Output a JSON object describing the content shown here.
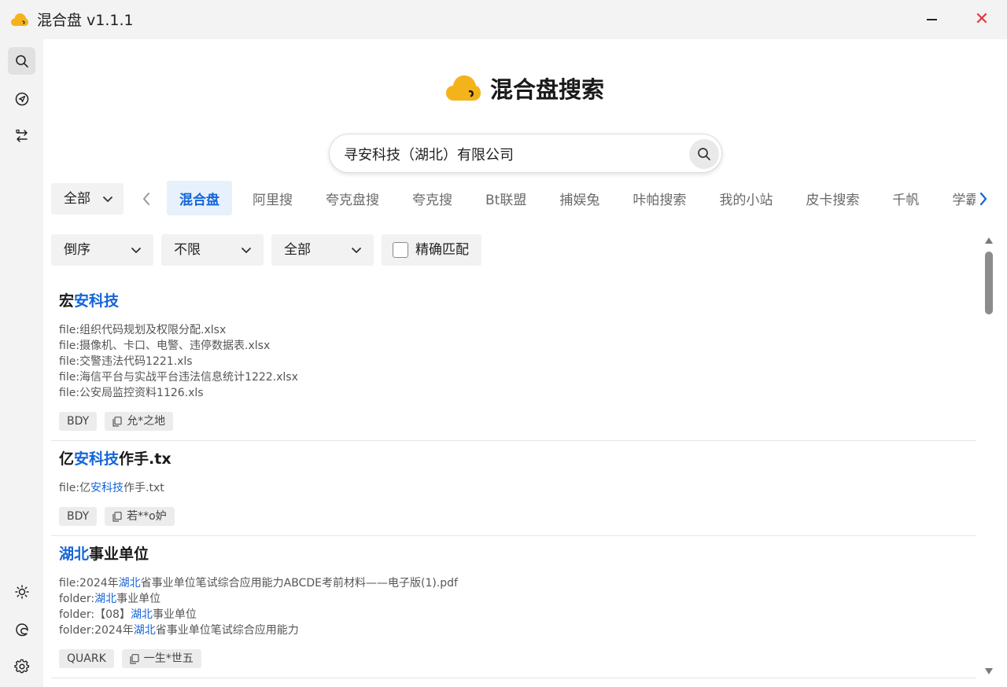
{
  "window": {
    "title": "混合盘 v1.1.1",
    "close_glyph": "✕",
    "accent_color": "#1565d8",
    "logo_color": "#f5b31b"
  },
  "sidebar": {
    "top": [
      {
        "icon": "search-icon",
        "active": true
      },
      {
        "icon": "send-icon",
        "active": false
      },
      {
        "icon": "transfer-icon",
        "active": false
      }
    ],
    "bottom": [
      {
        "icon": "theme-icon"
      },
      {
        "icon": "edge-icon"
      },
      {
        "icon": "settings-icon"
      }
    ]
  },
  "header": {
    "brand_title": "混合盘搜索"
  },
  "search": {
    "query": "寻安科技（湖北）有限公司"
  },
  "scope": {
    "selected": "全部"
  },
  "tabs": [
    "混合盘",
    "阿里搜",
    "夸克盘搜",
    "夸克搜",
    "Bt联盟",
    "捕娱兔",
    "咔帕搜索",
    "我的小站",
    "皮卡搜索",
    "千帆",
    "学霸"
  ],
  "active_tab": "混合盘",
  "filters": {
    "order": "倒序",
    "time": "不限",
    "type": "全部",
    "exact_label": "精确匹配",
    "exact_checked": false
  },
  "results": [
    {
      "title_parts": [
        {
          "t": "宏",
          "hl": false
        },
        {
          "t": "安科技",
          "hl": true
        }
      ],
      "files": [
        [
          {
            "t": "file:组织代码规划及权限分配.xlsx",
            "hl": false
          }
        ],
        [
          {
            "t": "file:摄像机、卡口、电警、违停数据表.xlsx",
            "hl": false
          }
        ],
        [
          {
            "t": "file:交警违法代码1221.xls",
            "hl": false
          }
        ],
        [
          {
            "t": "file:海信平台与实战平台违法信息统计1222.xlsx",
            "hl": false
          }
        ],
        [
          {
            "t": "file:公安局监控资料1126.xls",
            "hl": false
          }
        ]
      ],
      "source": "BDY",
      "owner": "允*之地"
    },
    {
      "title_parts": [
        {
          "t": "亿",
          "hl": false
        },
        {
          "t": "安科技",
          "hl": true
        },
        {
          "t": "作手.tx",
          "hl": false
        }
      ],
      "files": [
        [
          {
            "t": "file:亿",
            "hl": false
          },
          {
            "t": "安科技",
            "hl": true
          },
          {
            "t": "作手.txt",
            "hl": false
          }
        ]
      ],
      "source": "BDY",
      "owner": "若**o妒"
    },
    {
      "title_parts": [
        {
          "t": "湖北",
          "hl": true
        },
        {
          "t": "事业单位",
          "hl": false
        }
      ],
      "files": [
        [
          {
            "t": "file:2024年",
            "hl": false
          },
          {
            "t": "湖北",
            "hl": true
          },
          {
            "t": "省事业单位笔试综合应用能力ABCDE考前材料——电子版(1).pdf",
            "hl": false
          }
        ],
        [
          {
            "t": "folder:",
            "hl": false
          },
          {
            "t": "湖北",
            "hl": true
          },
          {
            "t": "事业单位",
            "hl": false
          }
        ],
        [
          {
            "t": "folder:【08】",
            "hl": false
          },
          {
            "t": "湖北",
            "hl": true
          },
          {
            "t": "事业单位",
            "hl": false
          }
        ],
        [
          {
            "t": "folder:2024年",
            "hl": false
          },
          {
            "t": "湖北",
            "hl": true
          },
          {
            "t": "省事业单位笔试综合应用能力",
            "hl": false
          }
        ]
      ],
      "source": "QUARK",
      "owner": "一生*世五"
    }
  ]
}
